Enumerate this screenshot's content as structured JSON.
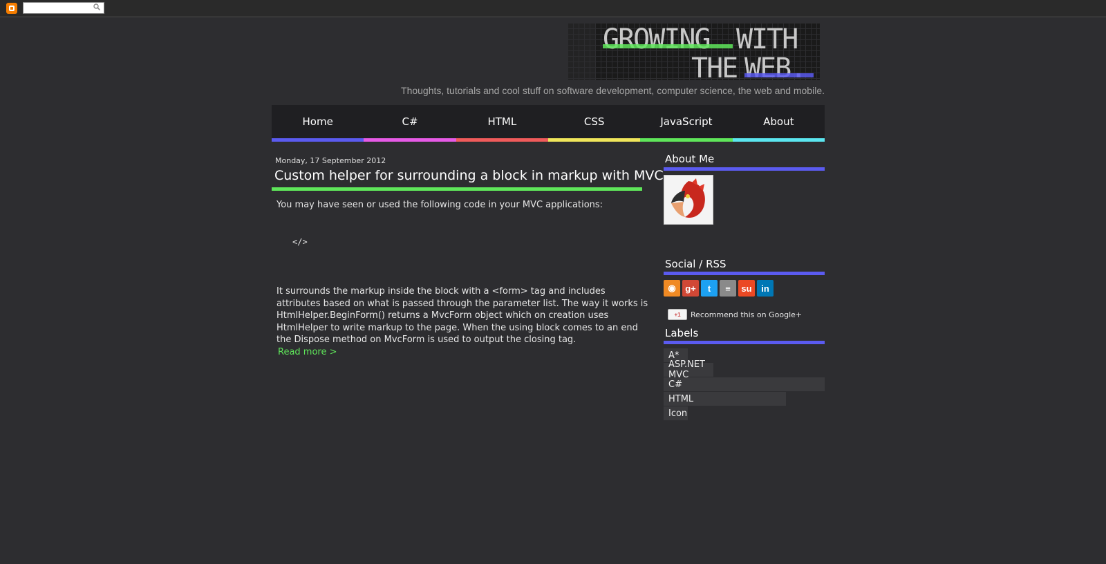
{
  "navbar": {
    "search_placeholder": ""
  },
  "header": {
    "logo_line1_a": "GROWING",
    "logo_line1_b": "WITH",
    "logo_line2_a": "THE",
    "logo_line2_b": "WEB.",
    "tagline": "Thoughts, tutorials and cool stuff on software development, computer science, the web and mobile."
  },
  "tabs": [
    {
      "label": "Home",
      "color": "#5b5bf0"
    },
    {
      "label": "C#",
      "color": "#e65ae6"
    },
    {
      "label": "HTML",
      "color": "#f05b5b"
    },
    {
      "label": "CSS",
      "color": "#f0e65b"
    },
    {
      "label": "JavaScript",
      "color": "#5fe65a"
    },
    {
      "label": "About",
      "color": "#5be6f0"
    }
  ],
  "post": {
    "date": "Monday, 17 September 2012",
    "title": "Custom helper for surrounding a block in markup with MVC",
    "intro": "You may have seen or used the following code in your MVC applications:",
    "code": "</>",
    "body": "It surrounds the markup inside the block with a <form> tag and includes attributes based on what is passed through the parameter list. The way it works is HtmlHelper.BeginForm() returns a MvcForm object which on creation uses HtmlHelper to write markup to the page. When the using block comes to an end the Dispose method on MvcForm is used to output the closing tag.",
    "read_more": "Read more >"
  },
  "sidebar": {
    "about_heading": "About Me",
    "social_heading": "Social / RSS",
    "social_icons": [
      {
        "name": "rss-icon",
        "glyph": "◉",
        "color": "#f08a24"
      },
      {
        "name": "google-plus-icon",
        "glyph": "g+",
        "color": "#d14836"
      },
      {
        "name": "twitter-icon",
        "glyph": "t",
        "color": "#1da1f2"
      },
      {
        "name": "stackoverflow-icon",
        "glyph": "≡",
        "color": "#8a8a8a"
      },
      {
        "name": "stumbleupon-icon",
        "glyph": "su",
        "color": "#eb4924"
      },
      {
        "name": "linkedin-icon",
        "glyph": "in",
        "color": "#0077b5"
      }
    ],
    "gplus_button": "+1",
    "gplus_text": "Recommend this on Google+",
    "labels_heading": "Labels",
    "labels": [
      {
        "label": "A*",
        "fill": 0.15
      },
      {
        "label": "ASP.NET MVC",
        "fill": 0.31
      },
      {
        "label": "C#",
        "fill": 1.0
      },
      {
        "label": "HTML",
        "fill": 0.76
      },
      {
        "label": "Icon",
        "fill": 0.15
      }
    ]
  },
  "colors": {
    "accent_blue": "#5b5bf0",
    "accent_green": "#5fe65a",
    "background": "#2d2d30"
  }
}
